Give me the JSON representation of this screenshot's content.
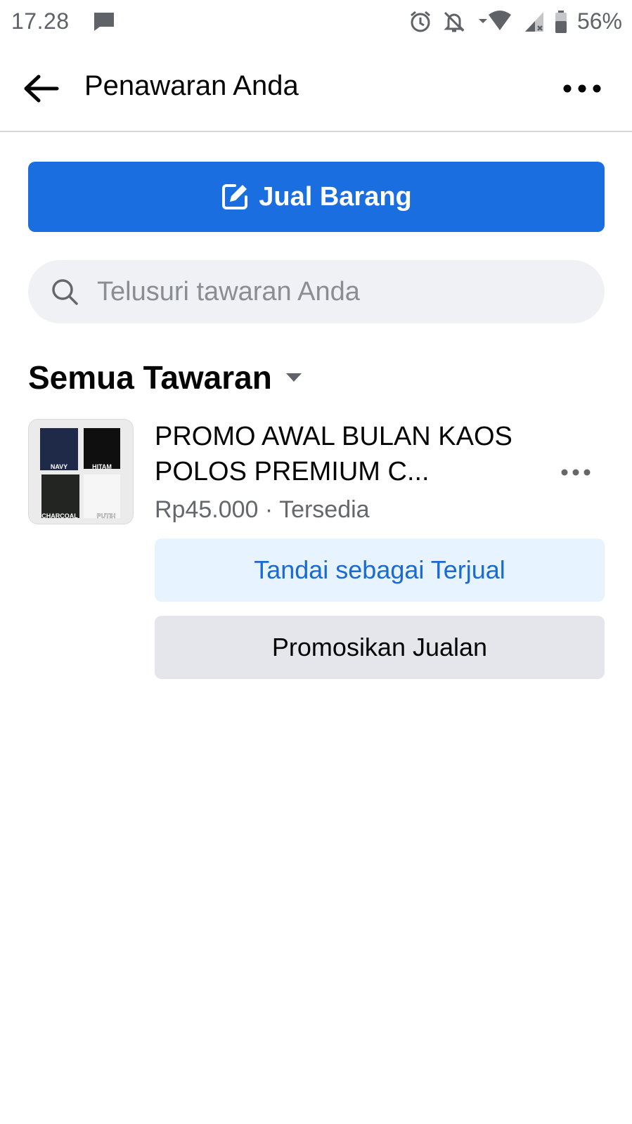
{
  "status_bar": {
    "time": "17.28",
    "battery_percent": "56%",
    "icons": [
      "message-icon",
      "alarm-icon",
      "notifications-off-icon",
      "wifi-icon",
      "signal-icon",
      "battery-icon"
    ]
  },
  "header": {
    "title": "Penawaran Anda",
    "back_icon": "arrow-left-icon",
    "more_icon": "more-horizontal-icon"
  },
  "sell_button": {
    "label": "Jual Barang",
    "icon": "edit-icon",
    "color": "#1b6edf"
  },
  "search": {
    "placeholder": "Telusuri tawaran Anda",
    "value": ""
  },
  "section": {
    "title": "Semua Tawaran",
    "icon": "caret-down-icon"
  },
  "listings": [
    {
      "title": "PROMO AWAL BULAN KAOS POLOS PREMIUM C...",
      "price": "Rp45.000",
      "separator": " · ",
      "status": "Tersedia",
      "thumbnail_labels": [
        "NAVY",
        "HITAM",
        "CHARCOAL",
        "PUTIH"
      ],
      "mark_sold_label": "Tandai sebagai Terjual",
      "promote_label": "Promosikan Jualan"
    }
  ],
  "colors": {
    "primary": "#1b6edf",
    "secondary_bg": "#e7f3ff",
    "neutral_bg": "#e4e6eb",
    "muted_text": "#65676b"
  }
}
